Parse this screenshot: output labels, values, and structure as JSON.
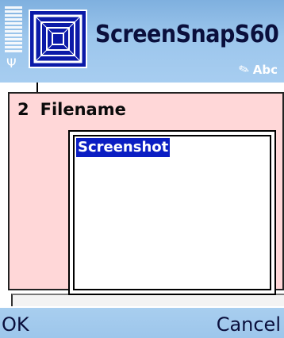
{
  "app": {
    "title": "ScreenSnapS60",
    "icon": "concentric-squares-icon"
  },
  "status": {
    "input_mode": "Abc",
    "input_icon": "pen-icon",
    "signal_icon": "signal-strength-icon",
    "antenna_icon": "antenna-icon"
  },
  "dialog": {
    "number": "2",
    "prompt": "Filename",
    "field_value": "Screenshot"
  },
  "softkeys": {
    "left": "OK",
    "right": "Cancel"
  },
  "colors": {
    "statusbar": "#9cc6ec",
    "dialog_bg": "#ffd7d8",
    "selection": "#0b1ec3",
    "app_icon_bg": "#0b1aa8"
  }
}
